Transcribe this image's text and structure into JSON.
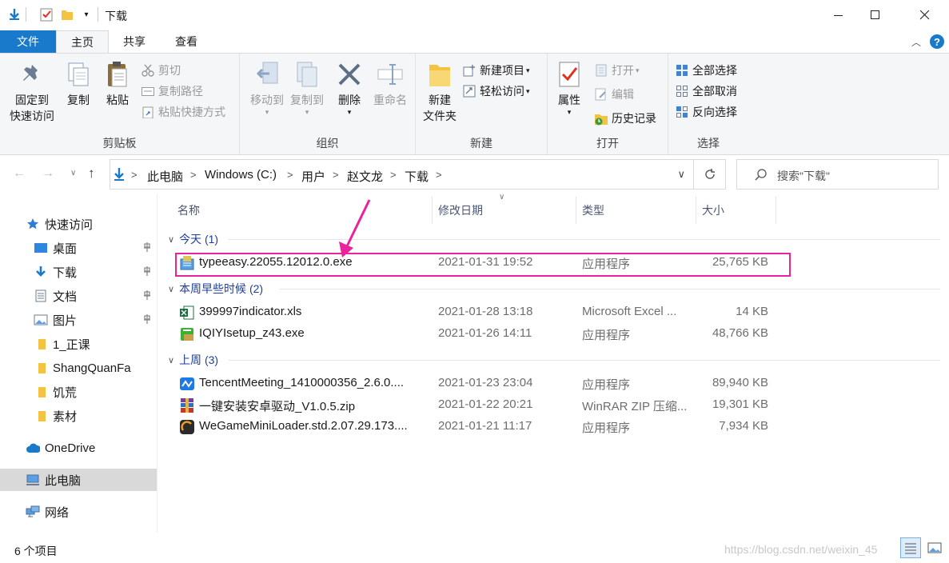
{
  "window": {
    "title": "下载"
  },
  "ribbon_tabs": {
    "file": "文件",
    "home": "主页",
    "share": "共享",
    "view": "查看"
  },
  "ribbon": {
    "clipboard": {
      "label": "剪贴板",
      "pin_line1": "固定到",
      "pin_line2": "快速访问",
      "copy": "复制",
      "paste": "粘贴",
      "cut": "剪切",
      "copy_path": "复制路径",
      "paste_shortcut": "粘贴快捷方式"
    },
    "organize": {
      "label": "组织",
      "move_to": "移动到",
      "copy_to": "复制到",
      "delete": "删除",
      "rename": "重命名"
    },
    "new": {
      "label": "新建",
      "new_folder_line1": "新建",
      "new_folder_line2": "文件夹",
      "new_item": "新建项目",
      "easy_access": "轻松访问"
    },
    "open": {
      "label": "打开",
      "properties": "属性",
      "open": "打开",
      "edit": "编辑",
      "history": "历史记录"
    },
    "select": {
      "label": "选择",
      "select_all": "全部选择",
      "select_none": "全部取消",
      "invert": "反向选择"
    }
  },
  "address": {
    "crumbs": [
      "此电脑",
      "Windows (C:)",
      "用户",
      "赵文龙",
      "下载"
    ],
    "search_placeholder": "搜索\"下载\""
  },
  "nav": {
    "quick_access": "快速访问",
    "items": [
      {
        "label": "桌面",
        "pinned": true
      },
      {
        "label": "下载",
        "pinned": true
      },
      {
        "label": "文档",
        "pinned": true
      },
      {
        "label": "图片",
        "pinned": true
      },
      {
        "label": "1_正课",
        "pinned": false
      },
      {
        "label": "ShangQuanFa",
        "pinned": false
      },
      {
        "label": "饥荒",
        "pinned": false
      },
      {
        "label": "素材",
        "pinned": false
      }
    ],
    "onedrive": "OneDrive",
    "this_pc": "此电脑",
    "network": "网络"
  },
  "columns": {
    "name": "名称",
    "date": "修改日期",
    "type": "类型",
    "size": "大小"
  },
  "groups": [
    {
      "header": "今天 (1)",
      "files": [
        {
          "name": "typeeasy.22055.12012.0.exe",
          "date": "2021-01-31 19:52",
          "type": "应用程序",
          "size": "25,765 KB"
        }
      ]
    },
    {
      "header": "本周早些时候 (2)",
      "files": [
        {
          "name": "399997indicator.xls",
          "date": "2021-01-28 13:18",
          "type": "Microsoft Excel ...",
          "size": "14 KB"
        },
        {
          "name": "IQIYIsetup_z43.exe",
          "date": "2021-01-26 14:11",
          "type": "应用程序",
          "size": "48,766 KB"
        }
      ]
    },
    {
      "header": "上周 (3)",
      "files": [
        {
          "name": "TencentMeeting_1410000356_2.6.0....",
          "date": "2021-01-23 23:04",
          "type": "应用程序",
          "size": "89,940 KB"
        },
        {
          "name": "一键安装安卓驱动_V1.0.5.zip",
          "date": "2021-01-22 20:21",
          "type": "WinRAR ZIP 压缩...",
          "size": "19,301 KB"
        },
        {
          "name": "WeGameMiniLoader.std.2.07.29.173....",
          "date": "2021-01-21 11:17",
          "type": "应用程序",
          "size": "7,934 KB"
        }
      ]
    }
  ],
  "status": {
    "count": "6 个项目",
    "watermark": "https://blog.csdn.net/weixin_45"
  },
  "colors": {
    "accent": "#1979ca",
    "highlight": "#e8239c",
    "group_text": "#1e3f9a"
  }
}
